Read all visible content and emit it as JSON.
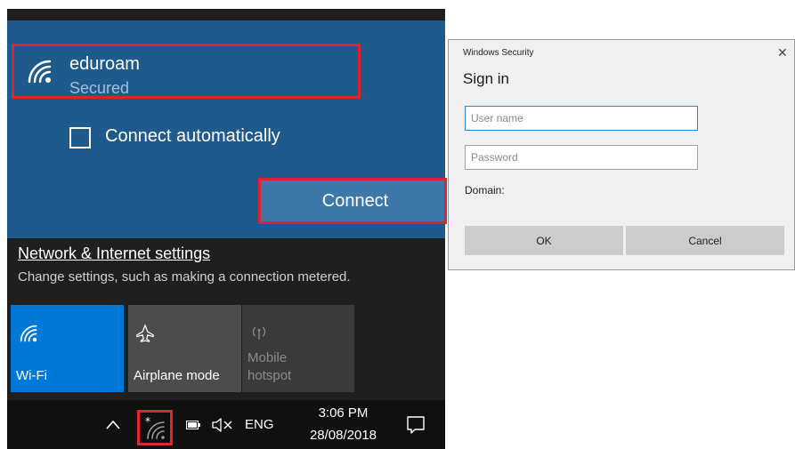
{
  "network": {
    "ssid": "eduroam",
    "security": "Secured",
    "auto_connect_label": "Connect automatically",
    "auto_connect_checked": false,
    "connect_label": "Connect"
  },
  "settings": {
    "link_label": "Network & Internet settings",
    "description": "Change settings, such as making a connection metered."
  },
  "tiles": [
    {
      "label": "Wi-Fi",
      "icon": "wifi-icon",
      "active": true
    },
    {
      "label": "Airplane mode",
      "icon": "airplane-icon",
      "active": false
    },
    {
      "label": "Mobile\nhotspot",
      "icon": "hotspot-icon",
      "active": false
    }
  ],
  "taskbar": {
    "language": "ENG",
    "time": "3:06 PM",
    "date": "28/08/2018"
  },
  "dialog": {
    "window_title": "Windows Security",
    "close_glyph": "✕",
    "heading": "Sign in",
    "username_placeholder": "User name",
    "password_placeholder": "Password",
    "domain_label": "Domain:",
    "ok_label": "OK",
    "cancel_label": "Cancel"
  },
  "colors": {
    "accent_blue": "#0078d7",
    "panel_blue": "#1f5a8c",
    "highlight_red": "#e0242e"
  }
}
